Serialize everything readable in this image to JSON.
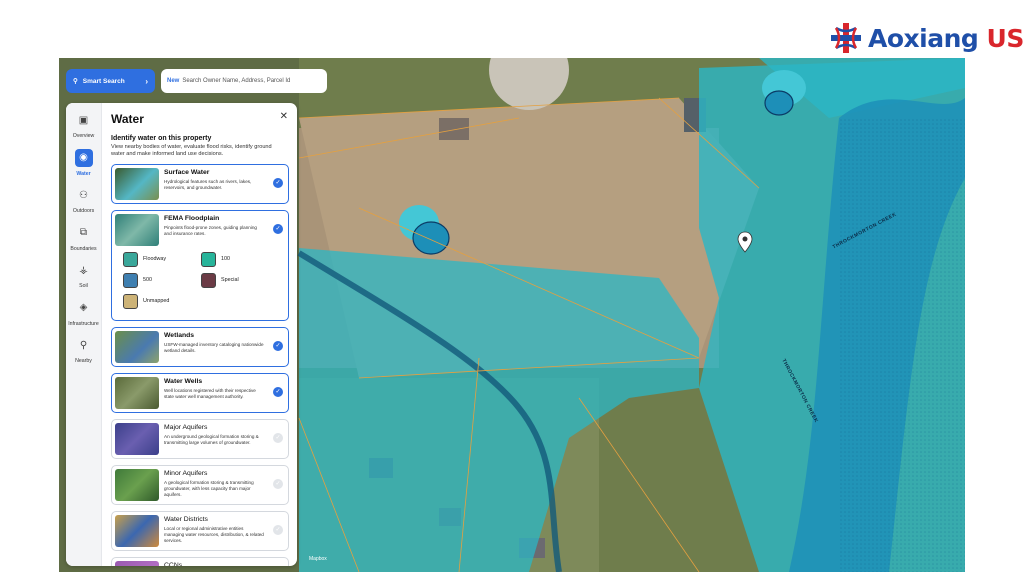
{
  "brand": {
    "name_a": "Aoxiang",
    "name_b": "US"
  },
  "search": {
    "smart_label": "Smart Search",
    "new_label": "New",
    "placeholder": "Search Owner Name, Address, Parcel Id"
  },
  "rail": [
    {
      "label": "Overview",
      "icon": "picture-icon",
      "glyph": "▣"
    },
    {
      "label": "Water",
      "icon": "water-drop-icon",
      "glyph": "◉"
    },
    {
      "label": "Outdoors",
      "icon": "people-icon",
      "glyph": "⚇"
    },
    {
      "label": "Boundaries",
      "icon": "boundary-icon",
      "glyph": "⧉"
    },
    {
      "label": "Soil",
      "icon": "soil-icon",
      "glyph": "⚶"
    },
    {
      "label": "Infrastructure",
      "icon": "infrastructure-icon",
      "glyph": "◈"
    },
    {
      "label": "Nearby",
      "icon": "location-pin-icon",
      "glyph": "⚲"
    }
  ],
  "panel": {
    "title": "Water",
    "heading": "Identify water on this property",
    "description": "View nearby bodies of water, evaluate flood risks, identify ground water and make informed land use decisions."
  },
  "layers": [
    {
      "title": "Surface Water",
      "desc": "Hydrological features such as rivers, lakes, reservoirs, and groundwater.",
      "checked": true
    },
    {
      "title": "FEMA Floodplain",
      "desc": "Pinpoints flood-prone zones, guiding planning and insurance rates.",
      "checked": true
    },
    {
      "title": "Wetlands",
      "desc": "USFW-managed inventory cataloging nationwide wetland details.",
      "checked": true
    },
    {
      "title": "Water Wells",
      "desc": "Well locations registered with their respective state water well management authority.",
      "checked": true
    },
    {
      "title": "Major Aquifers",
      "desc": "An underground geological formation storing & transmitting large volumes of groundwater.",
      "checked": false
    },
    {
      "title": "Minor Aquifers",
      "desc": "A geological formation storing & transmitting groundwater, with less capacity than major aquifers.",
      "checked": false
    },
    {
      "title": "Water Districts",
      "desc": "Local or regional administrative entities managing water resources, distribution, & related services.",
      "checked": false
    },
    {
      "title": "CCNs",
      "desc": "",
      "checked": false
    }
  ],
  "floodplain_legend": [
    {
      "label": "Floodway",
      "color": "#3aa79a"
    },
    {
      "label": "100",
      "color": "#27b49a"
    },
    {
      "label": "500",
      "color": "#3f7fb0"
    },
    {
      "label": "Special",
      "color": "#6b3b45"
    },
    {
      "label": "Unmapped",
      "color": "#cdb377"
    }
  ],
  "map": {
    "creek_label_1": "THROCKMORTON CREEK",
    "creek_label_2": "THROCKMORTON CREEK",
    "attribution": "Mapbox",
    "flood_color": "#2bb7c6",
    "floodway_color": "#1d8fb8"
  },
  "colors": {
    "accent": "#2f6fe0",
    "brand_blue": "#1f4fa8",
    "brand_red": "#d9262c"
  }
}
